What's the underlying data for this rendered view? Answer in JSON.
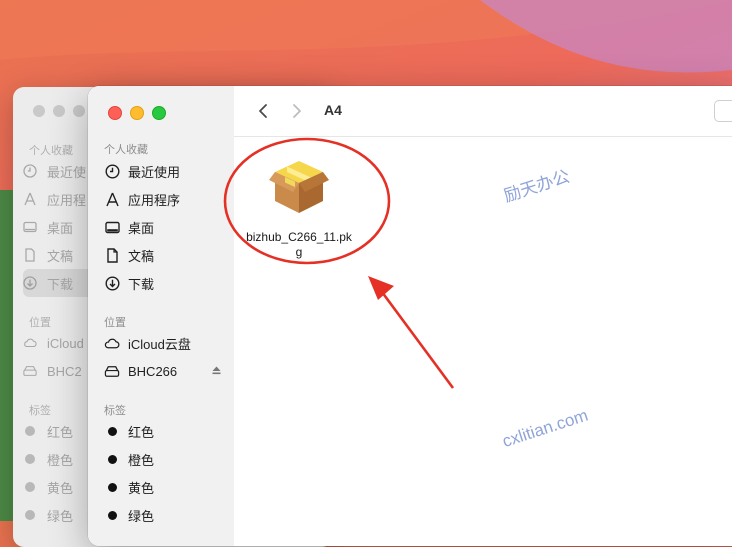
{
  "back_window": {
    "sections": {
      "favorites": "个人收藏",
      "locations": "位置",
      "tags": "标签"
    },
    "favorites": [
      "最近使",
      "应用程",
      "桌面",
      "文稿",
      "下载"
    ],
    "locations": [
      "iCloud",
      "BHC2"
    ],
    "tags": [
      "红色",
      "橙色",
      "黄色",
      "绿色"
    ]
  },
  "sidebar": {
    "sections": {
      "favorites": "个人收藏",
      "locations": "位置",
      "tags": "标签"
    },
    "favorites": [
      {
        "label": "最近使用",
        "icon": "clock-icon"
      },
      {
        "label": "应用程序",
        "icon": "apps-icon"
      },
      {
        "label": "桌面",
        "icon": "desktop-icon"
      },
      {
        "label": "文稿",
        "icon": "document-icon"
      },
      {
        "label": "下载",
        "icon": "download-icon"
      }
    ],
    "locations": [
      {
        "label": "iCloud云盘",
        "icon": "cloud-icon"
      },
      {
        "label": "BHC266",
        "icon": "drive-icon"
      }
    ],
    "tags": [
      {
        "label": "红色",
        "color": "#111111"
      },
      {
        "label": "橙色",
        "color": "#111111"
      },
      {
        "label": "黄色",
        "color": "#111111"
      },
      {
        "label": "绿色",
        "color": "#111111"
      }
    ]
  },
  "toolbar": {
    "title": "A4"
  },
  "files": [
    {
      "name": "bizhub_C266_11.pkg",
      "icon": "package-icon"
    }
  ],
  "watermarks": {
    "cn": "励天办公",
    "url": "cxlitian.com"
  },
  "colors": {
    "annotation": "#e53125",
    "close": "#fe5f57",
    "minimize": "#febc2e",
    "maximize": "#28c840"
  }
}
